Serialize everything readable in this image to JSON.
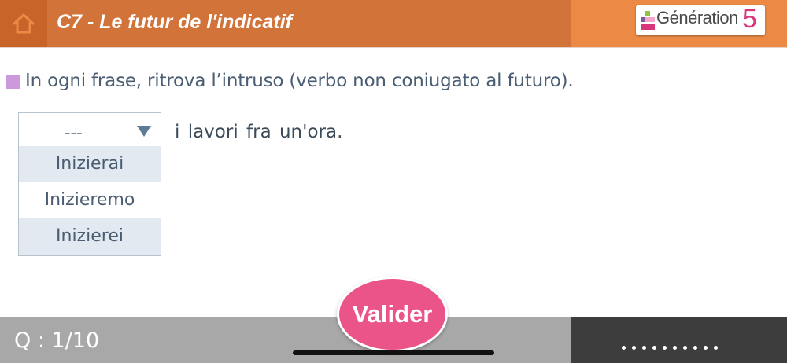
{
  "header": {
    "title": "C7 - Le futur de l'indicatif",
    "home_icon": "home-icon",
    "logo": {
      "text": "Génération",
      "number": "5"
    },
    "colors": {
      "bar": "#ec8a45",
      "title_bar": "#d2733a",
      "home": "#c8642a"
    }
  },
  "exercise": {
    "instruction": "In ogni frase, ritrova l’intruso (verbo non coniugato al futuro).",
    "dropdown": {
      "selected": "---",
      "options": [
        "Inizierai",
        "Inizieremo",
        "Inizierei"
      ]
    },
    "sentence_rest": "i lavori fra un'ora."
  },
  "footer": {
    "counter": "Q : 1/10",
    "validate_label": "Valider",
    "accent_color": "#ea5488"
  }
}
